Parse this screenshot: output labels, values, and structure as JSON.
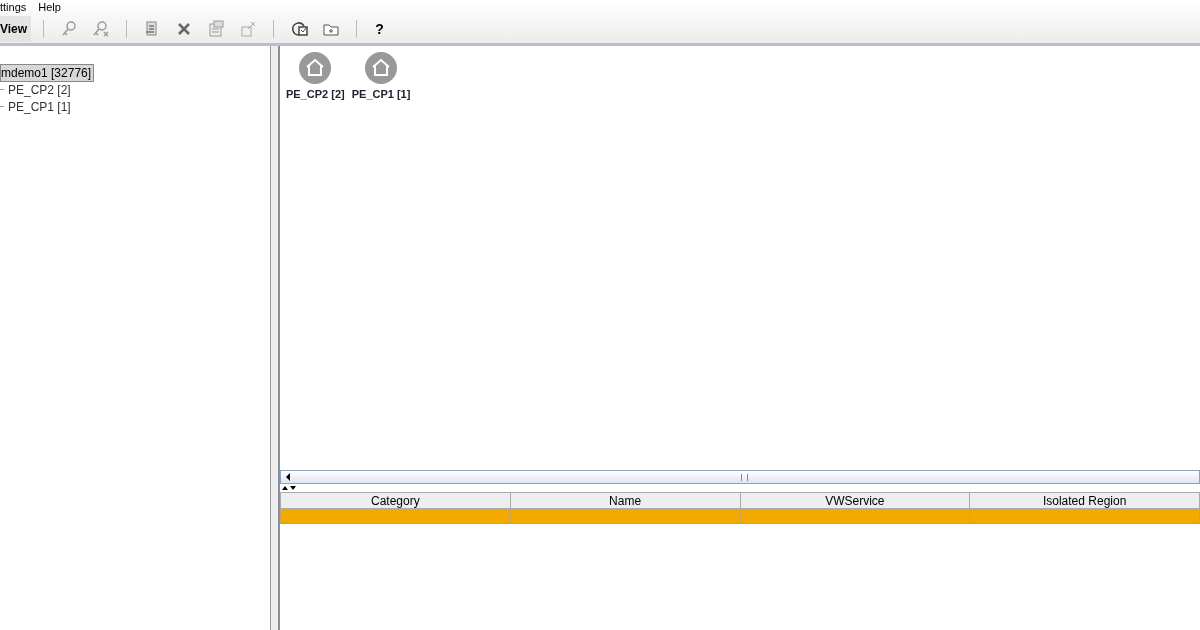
{
  "menu_bar": [
    "ttings",
    "Help"
  ],
  "toolbar": {
    "tab": {
      "label": "View",
      "selected": true
    },
    "tools": [
      {
        "kind": "key"
      },
      {
        "kind": "key-x"
      },
      {
        "kind": "sep"
      },
      {
        "kind": "doc"
      },
      {
        "kind": "x"
      },
      {
        "kind": "props"
      },
      {
        "kind": "diag"
      },
      {
        "kind": "sep"
      },
      {
        "kind": "refresh"
      },
      {
        "kind": "folder"
      },
      {
        "kind": "sep"
      },
      {
        "kind": "text",
        "label": "?"
      }
    ]
  },
  "tree": {
    "label": "mdemo1 [32776]",
    "selected": true,
    "children": [
      {
        "label": "PE_CP2 [2]",
        "selected": false
      },
      {
        "label": "PE_CP1 [1]",
        "selected": false
      }
    ]
  },
  "canvas_nodes": [
    {
      "label": "PE_CP2 [2]"
    },
    {
      "label": "PE_CP1 [1]"
    }
  ],
  "table": {
    "columns": [
      "Category",
      "Name",
      "VWService",
      "Isolated Region"
    ],
    "rows": [
      {
        "selected": true
      }
    ]
  }
}
